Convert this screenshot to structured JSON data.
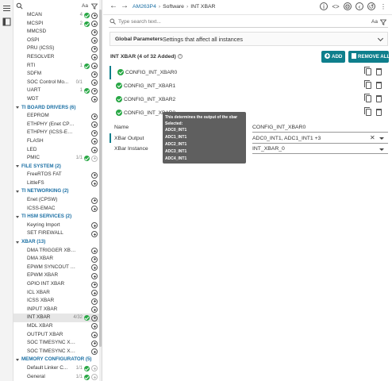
{
  "sidebar": {
    "aa_label": "Aa",
    "items": [
      {
        "kind": "item",
        "label": "MCAN",
        "count": "4",
        "checked": true
      },
      {
        "kind": "item",
        "label": "MCSPI",
        "count": "2",
        "checked": true
      },
      {
        "kind": "item",
        "label": "MMCSD",
        "count": "",
        "checked": false
      },
      {
        "kind": "item",
        "label": "OSPI",
        "count": "",
        "checked": false
      },
      {
        "kind": "item",
        "label": "PRU (ICSS)",
        "count": "",
        "checked": false
      },
      {
        "kind": "item",
        "label": "RESOLVER",
        "count": "",
        "checked": false
      },
      {
        "kind": "item",
        "label": "RTI",
        "count": "1",
        "checked": true
      },
      {
        "kind": "item",
        "label": "SDFM",
        "count": "",
        "checked": false
      },
      {
        "kind": "item",
        "label": "SOC Control Mo...",
        "count": "0/1",
        "checked": false
      },
      {
        "kind": "item",
        "label": "UART",
        "count": "1",
        "checked": true
      },
      {
        "kind": "item",
        "label": "WDT",
        "count": "",
        "checked": false
      },
      {
        "kind": "cat",
        "label": "TI BOARD DRIVERS (6)"
      },
      {
        "kind": "item",
        "label": "EEPROM",
        "count": "",
        "checked": false
      },
      {
        "kind": "item",
        "label": "ETHPHY (Enet CPSW/ICS...",
        "count": "",
        "checked": false
      },
      {
        "kind": "item",
        "label": "ETHPHY (ICSS-EMAC)",
        "count": "",
        "checked": false
      },
      {
        "kind": "item",
        "label": "FLASH",
        "count": "",
        "checked": false
      },
      {
        "kind": "item",
        "label": "LED",
        "count": "",
        "checked": false
      },
      {
        "kind": "item",
        "label": "PMIC",
        "count": "1/1",
        "checked": true,
        "disabled": true
      },
      {
        "kind": "cat",
        "label": "FILE SYSTEM (2)"
      },
      {
        "kind": "item",
        "label": "FreeRTOS FAT",
        "count": "",
        "checked": false
      },
      {
        "kind": "item",
        "label": "LittleFS",
        "count": "",
        "checked": false
      },
      {
        "kind": "cat",
        "label": "TI NETWORKING (2)"
      },
      {
        "kind": "item",
        "label": "Enet (CPSW)",
        "count": "",
        "checked": false
      },
      {
        "kind": "item",
        "label": "ICSS-EMAC",
        "count": "",
        "checked": false
      },
      {
        "kind": "cat",
        "label": "TI HSM SERVICES (2)"
      },
      {
        "kind": "item",
        "label": "Keyring Import",
        "count": "",
        "checked": false
      },
      {
        "kind": "item",
        "label": "SET FIREWALL",
        "count": "",
        "checked": false
      },
      {
        "kind": "cat",
        "label": "XBAR (13)"
      },
      {
        "kind": "item",
        "label": "DMA TRIGGER XBAR",
        "count": "",
        "checked": false
      },
      {
        "kind": "item",
        "label": "DMA XBAR",
        "count": "",
        "checked": false
      },
      {
        "kind": "item",
        "label": "EPWM SYNCOUT XBAR",
        "count": "",
        "checked": false
      },
      {
        "kind": "item",
        "label": "EPWM XBAR",
        "count": "",
        "checked": false
      },
      {
        "kind": "item",
        "label": "GPIO INT XBAR",
        "count": "",
        "checked": false
      },
      {
        "kind": "item",
        "label": "ICL XBAR",
        "count": "",
        "checked": false
      },
      {
        "kind": "item",
        "label": "ICSS XBAR",
        "count": "",
        "checked": false
      },
      {
        "kind": "item",
        "label": "INPUT XBAR",
        "count": "",
        "checked": false
      },
      {
        "kind": "item",
        "label": "INT XBAR",
        "count": "4/32",
        "checked": true,
        "selected": true
      },
      {
        "kind": "item",
        "label": "MDL XBAR",
        "count": "",
        "checked": false
      },
      {
        "kind": "item",
        "label": "OUTPUT XBAR",
        "count": "",
        "checked": false
      },
      {
        "kind": "item",
        "label": "SOC TIMESYNC XBAR 0",
        "count": "",
        "checked": false
      },
      {
        "kind": "item",
        "label": "SOC TIMESYNC XBAR 1",
        "count": "",
        "checked": false
      },
      {
        "kind": "cat",
        "label": "MEMORY CONFIGURATOR (5)"
      },
      {
        "kind": "item",
        "label": "Default Linker C...",
        "count": "1/1",
        "checked": true,
        "disabled": true
      },
      {
        "kind": "item",
        "label": "General",
        "count": "1/1",
        "checked": true,
        "disabled": true
      }
    ]
  },
  "topbar": {
    "device": "AM263P4",
    "crumb_1": "Software",
    "crumb_2": "INT XBAR"
  },
  "search": {
    "placeholder": "Type search text...",
    "aa_label": "Aa"
  },
  "global_params": {
    "title": "Global Parameters",
    "description": "Settings that affect all instances"
  },
  "instances_header": {
    "title": "INT XBAR (4 of 32 Added)",
    "add_label": "ADD",
    "remove_all_label": "REMOVE ALL"
  },
  "instances": [
    {
      "name": "CONFIG_INT_XBAR0"
    },
    {
      "name": "CONFIG_INT_XBAR1"
    },
    {
      "name": "CONFIG_INT_XBAR2"
    },
    {
      "name": "CONFIG_INT_XBAR3"
    }
  ],
  "properties": {
    "name_label": "Name",
    "name_value": "CONFIG_INT_XBAR0",
    "output_label": "XBar Output",
    "output_value": "ADC0_INT1, ADC1_INT1 +3",
    "instance_label": "XBar Instance",
    "instance_value": "INT_XBAR_0"
  },
  "tooltip": {
    "title": "This determines the output of the xbar",
    "selected_label": "Selected:",
    "items": [
      "ADC0_INT1",
      "ADC1_INT1",
      "ADC2_INT1",
      "ADC3_INT1",
      "ADC4_INT1"
    ]
  },
  "colors": {
    "accent": "#0e7f8c",
    "check": "#27a744",
    "category": "#1a6fa4",
    "tooltip_bg": "#5f5f5f"
  }
}
